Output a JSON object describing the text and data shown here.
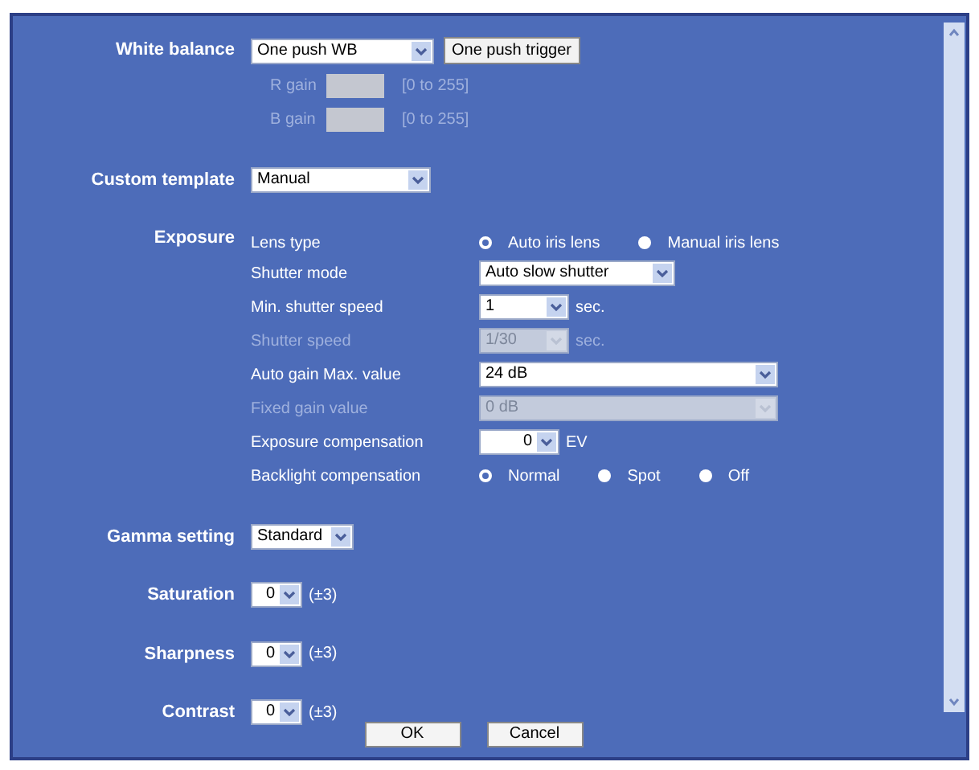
{
  "white_balance": {
    "label": "White balance",
    "select": {
      "value": "One push WB",
      "disabled": false
    },
    "trigger_button": "One push trigger",
    "gains": [
      {
        "label": "R gain",
        "range": "[0 to 255]",
        "disabled": true
      },
      {
        "label": "B gain",
        "range": "[0 to 255]",
        "disabled": true
      }
    ]
  },
  "custom_template": {
    "label": "Custom template",
    "select": {
      "value": "Manual",
      "disabled": false
    }
  },
  "exposure": {
    "label": "Exposure",
    "rows": [
      {
        "kind": "radio",
        "label": "Lens type",
        "options": [
          {
            "label": "Auto iris lens",
            "selected": true
          },
          {
            "label": "Manual iris lens",
            "selected": false
          }
        ]
      },
      {
        "kind": "select",
        "label": "Shutter mode",
        "value": "Auto slow shutter",
        "disabled": false
      },
      {
        "kind": "select",
        "label": "Min. shutter speed",
        "value": "1",
        "unit": "sec.",
        "disabled": false
      },
      {
        "kind": "select",
        "label": "Shutter speed",
        "value": "1/30",
        "unit": "sec.",
        "disabled": true
      },
      {
        "kind": "select",
        "label": "Auto gain Max. value",
        "value": "24 dB",
        "disabled": false
      },
      {
        "kind": "select",
        "label": "Fixed gain value",
        "value": "0 dB",
        "disabled": true
      },
      {
        "kind": "select",
        "label": "Exposure compensation",
        "value": "0",
        "unit": "EV",
        "disabled": false
      },
      {
        "kind": "radio",
        "label": "Backlight compensation",
        "options": [
          {
            "label": "Normal",
            "selected": true
          },
          {
            "label": "Spot",
            "selected": false
          },
          {
            "label": "Off",
            "selected": false
          }
        ]
      }
    ]
  },
  "gamma": {
    "label": "Gamma setting",
    "select": {
      "value": "Standard",
      "disabled": false
    }
  },
  "adjustments": [
    {
      "label": "Saturation",
      "value": "0",
      "range": "(±3)"
    },
    {
      "label": "Sharpness",
      "value": "0",
      "range": "(±3)"
    },
    {
      "label": "Contrast",
      "value": "0",
      "range": "(±3)"
    }
  ],
  "buttons": [
    "OK",
    "Cancel"
  ]
}
